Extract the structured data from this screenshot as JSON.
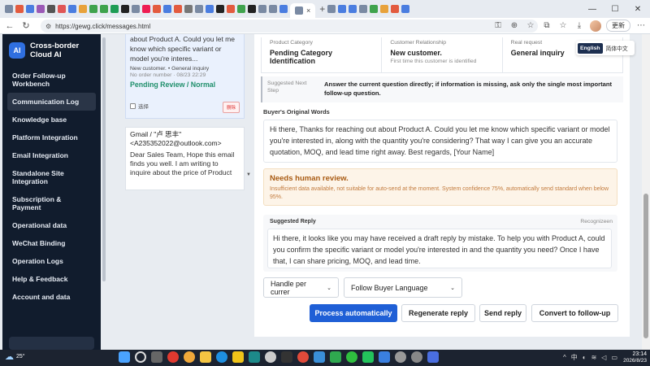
{
  "browser": {
    "url": "https://gewg.click/messages.html",
    "update_label": "更新",
    "tab_close": "×",
    "tab_add": "+",
    "win_min": "—",
    "win_max": "☐",
    "win_close": "✕"
  },
  "brand": {
    "logo": "AI",
    "name": "Cross-border Cloud AI",
    "logo_color": "#2f6fe0"
  },
  "sidebar": {
    "items": [
      {
        "label": "Order Follow-up Workbench",
        "active": false
      },
      {
        "label": "Communication Log",
        "active": true
      },
      {
        "label": "Knowledge base",
        "active": false
      },
      {
        "label": "Platform Integration",
        "active": false
      },
      {
        "label": "Email Integration",
        "active": false
      },
      {
        "label": "Standalone Site Integration",
        "active": false
      },
      {
        "label": "Subscription & Payment",
        "active": false
      },
      {
        "label": "Operational data",
        "active": false
      },
      {
        "label": "WeChat Binding",
        "active": false
      },
      {
        "label": "Operation Logs",
        "active": false
      },
      {
        "label": "Help & Feedback",
        "active": false
      },
      {
        "label": "Account and data",
        "active": false
      }
    ]
  },
  "messages": [
    {
      "body": "about Product A. Could you let me know which specific variant or model you're interes...",
      "meta_bold": "New customer. • General inquiry",
      "meta": "No order number · 08/23 22:29",
      "status": "Pending Review / Normal",
      "select_label": "选择",
      "delete_label": "删除"
    },
    {
      "sender": "Gmail / \"卢 思丰\" <A235352022@outlook.com>",
      "body": "Dear Sales Team, Hope this email finds you well. I am writing to inquire about the price of Product"
    }
  ],
  "info": {
    "category_label": "Product Category",
    "category_value": "Pending Category Identification",
    "relationship_label": "Customer Relationship",
    "relationship_value": "New customer.",
    "relationship_sub": "First time this customer is identified",
    "request_label": "Real request",
    "request_value": "General inquiry"
  },
  "next_step": {
    "label": "Suggested Next Step",
    "text": "Answer the current question directly; if information is missing, ask only the single most important follow-up question."
  },
  "original": {
    "title": "Buyer's Original Words",
    "text": "Hi there, Thanks for reaching out about Product A. Could you let me know which specific variant or model you're interested in, along with the quantity you're considering? That way I can give you an accurate quotation, MOQ, and lead time right away. Best regards, [Your Name]"
  },
  "review": {
    "title": "Needs human review.",
    "text": "Insufficient data available, not suitable for auto-send at the moment. System confidence 75%, automatically send standard when below 95%."
  },
  "suggested": {
    "label": "Suggested Reply",
    "reco": "Recognizeen",
    "text": "Hi there, it looks like you may have received a draft reply by mistake. To help you with Product A, could you confirm the specific variant or model you're interested in and the quantity you need? Once I have that, I can share pricing, MOQ, and lead time."
  },
  "selects": {
    "handle": "Handle per currer",
    "language": "Follow Buyer Language"
  },
  "buttons": {
    "process": "Process automatically",
    "regenerate": "Regenerate reply",
    "send": "Send reply",
    "convert": "Convert to follow-up"
  },
  "lang": {
    "en": "English",
    "zh": "简体中文"
  },
  "taskbar": {
    "temp": "25°",
    "time": "23:14",
    "date": "2026/8/23"
  },
  "colors": {
    "primary": "#1f5fd6",
    "sidebar_bg": "#111c2d",
    "status_green": "#1f8f6b",
    "review_orange": "#a85a12"
  }
}
